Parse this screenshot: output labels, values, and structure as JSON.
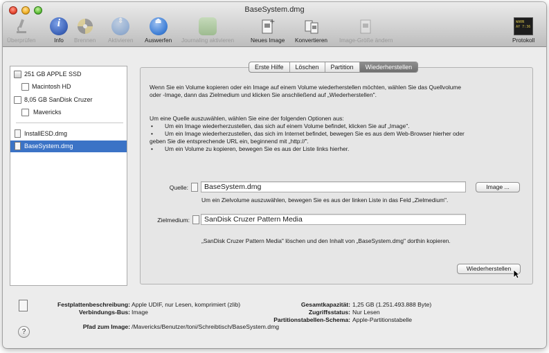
{
  "window": {
    "title": "BaseSystem.dmg"
  },
  "toolbar": {
    "items": [
      {
        "label": "Überprüfen",
        "icon": "microscope-icon",
        "enabled": false
      },
      {
        "label": "Info",
        "icon": "info-icon",
        "enabled": true
      },
      {
        "label": "Brennen",
        "icon": "burn-disc-icon",
        "enabled": false
      },
      {
        "label": "Aktivieren",
        "icon": "mount-icon",
        "enabled": false
      },
      {
        "label": "Auswerfen",
        "icon": "eject-icon",
        "enabled": true
      },
      {
        "label": "Journaling aktivieren",
        "icon": "journaling-icon",
        "enabled": false
      },
      {
        "label": "Neues Image",
        "icon": "new-image-icon",
        "enabled": true
      },
      {
        "label": "Konvertieren",
        "icon": "convert-icon",
        "enabled": true
      },
      {
        "label": "Image-Größe ändern",
        "icon": "resize-image-icon",
        "enabled": false
      },
      {
        "label": "Protokoll",
        "icon": "log-icon",
        "enabled": true
      }
    ],
    "log_badge": "WARN\nAY 7:36"
  },
  "sidebar": {
    "items": [
      {
        "label": "251 GB APPLE SSD",
        "icon": "internal-disk-icon"
      },
      {
        "label": "Macintosh HD",
        "icon": "volume-icon"
      },
      {
        "label": "8,05 GB SanDisk Cruzer",
        "icon": "external-disk-icon"
      },
      {
        "label": "Mavericks",
        "icon": "volume-icon"
      },
      {
        "label": "InstallESD.dmg",
        "icon": "dmg-file-icon"
      },
      {
        "label": "BaseSystem.dmg",
        "icon": "dmg-file-icon"
      }
    ],
    "selected": "BaseSystem.dmg"
  },
  "tabs": {
    "items": [
      "Erste Hilfe",
      "Löschen",
      "Partition",
      "Wiederherstellen"
    ],
    "active": "Wiederherstellen"
  },
  "restore": {
    "intro_line1": "Wenn Sie ein Volume kopieren oder ein Image auf einem Volume wiederherstellen möchten, wählen Sie das Quellvolume",
    "intro_line2": "oder -Image, dann das Zielmedium und klicken Sie anschließend auf „Wiederherstellen\".",
    "options_intro": "Um eine Quelle auszuwählen, wählen Sie eine der folgenden Optionen aus:",
    "bullet1": "Um ein Image wiederherzustellen, das sich auf einem Volume befindet, klicken Sie auf „Image\".",
    "bullet2_line1": "Um ein Image wiederherzustellen, das sich im Internet befindet, bewegen Sie es aus dem Web-Browser hierher oder",
    "bullet2_line2": "geben Sie die entsprechende URL ein, beginnend mit „http://\".",
    "bullet3": "Um ein Volume zu kopieren, bewegen Sie es aus der Liste links hierher.",
    "source_label": "Quelle:",
    "source_value": "BaseSystem.dmg",
    "image_button": "Image ...",
    "target_hint": "Um ein Zielvolume auszuwählen, bewegen Sie es aus der linken Liste in das Feld „Zielmedium\".",
    "target_label": "Zielmedium:",
    "target_value": "SanDisk Cruzer Pattern Media",
    "summary": "„SanDisk Cruzer Pattern Media\" löschen und den Inhalt von „BaseSystem.dmg\" dorthin kopieren.",
    "restore_button": "Wiederherstellen"
  },
  "info": {
    "desc_label": "Festplattenbeschreibung:",
    "desc_value": "Apple UDIF, nur Lesen, komprimiert (zlib)",
    "bus_label": "Verbindungs-Bus:",
    "bus_value": "Image",
    "path_label": "Pfad zum Image:",
    "path_value": "/Mavericks/Benutzer/toni/Schreibtisch/BaseSystem.dmg",
    "capacity_label": "Gesamtkapazität:",
    "capacity_value": "1,25 GB (1.251.493.888 Byte)",
    "access_label": "Zugriffsstatus:",
    "access_value": "Nur Lesen",
    "scheme_label": "Partitionstabellen-Schema:",
    "scheme_value": "Apple-Partitionstabelle",
    "help": "?"
  },
  "colors": {
    "selection": "#3b73c6",
    "info_blue": "#3d63b8",
    "eject_blue": "#3f7fd6"
  }
}
